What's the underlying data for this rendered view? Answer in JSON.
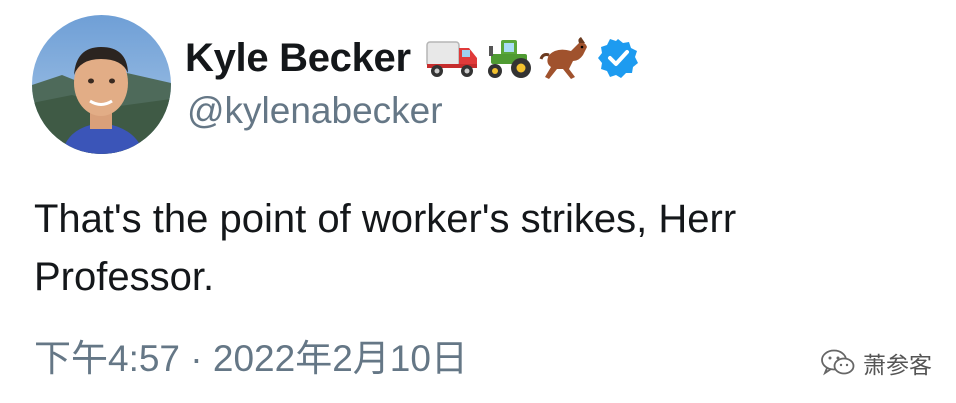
{
  "author": {
    "display_name": "Kyle Becker",
    "handle": "@kylenabecker",
    "avatar": "avatar",
    "verified": true,
    "name_emojis": [
      "truck-emoji",
      "tractor-emoji",
      "horse-emoji"
    ]
  },
  "tweet": {
    "text": "That's the point of worker's strikes, Herr Professor.",
    "timestamp": "下午4:57 · 2022年2月10日"
  },
  "watermark": {
    "icon": "wechat-icon",
    "label": "萧参客"
  },
  "colors": {
    "text": "#14171a",
    "secondary": "#657786",
    "verified_badge": "#1d9bf0"
  }
}
